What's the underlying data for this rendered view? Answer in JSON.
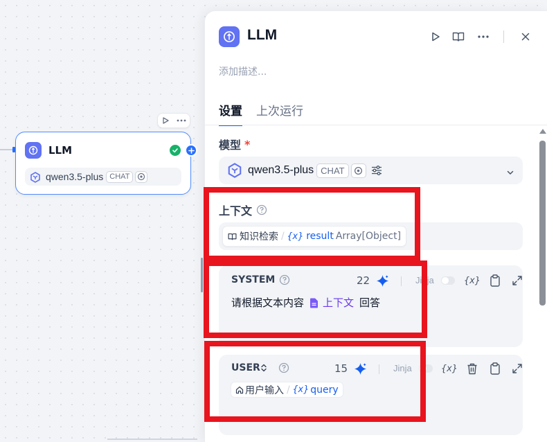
{
  "canvas": {
    "node": {
      "title": "LLM",
      "model_name": "qwen3.5-plus",
      "model_tag": "CHAT",
      "status": "success"
    }
  },
  "panel": {
    "title": "LLM",
    "description_placeholder": "添加描述...",
    "tabs": [
      {
        "label": "设置",
        "active": true
      },
      {
        "label": "上次运行",
        "active": false
      }
    ],
    "model": {
      "label": "模型",
      "required_mark": "*",
      "name": "qwen3.5-plus",
      "tag": "CHAT"
    },
    "context": {
      "label": "上下文",
      "node_name": "知识检索",
      "variable": "result",
      "type": "Array[Object]"
    },
    "system_prompt": {
      "role": "SYSTEM",
      "token_count": "22",
      "jinja_label": "Jinja",
      "text_before": "请根据文本内容",
      "context_ref": "上下文",
      "text_after": "回答"
    },
    "user_prompt": {
      "role": "USER",
      "token_count": "15",
      "jinja_label": "Jinja",
      "node_name": "用户输入",
      "variable": "query"
    }
  },
  "colors": {
    "accent": "#155eef",
    "node_icon": "#6172f3",
    "success": "#17b26a",
    "highlight": "#e8141e",
    "context_purple": "#6938ef"
  }
}
